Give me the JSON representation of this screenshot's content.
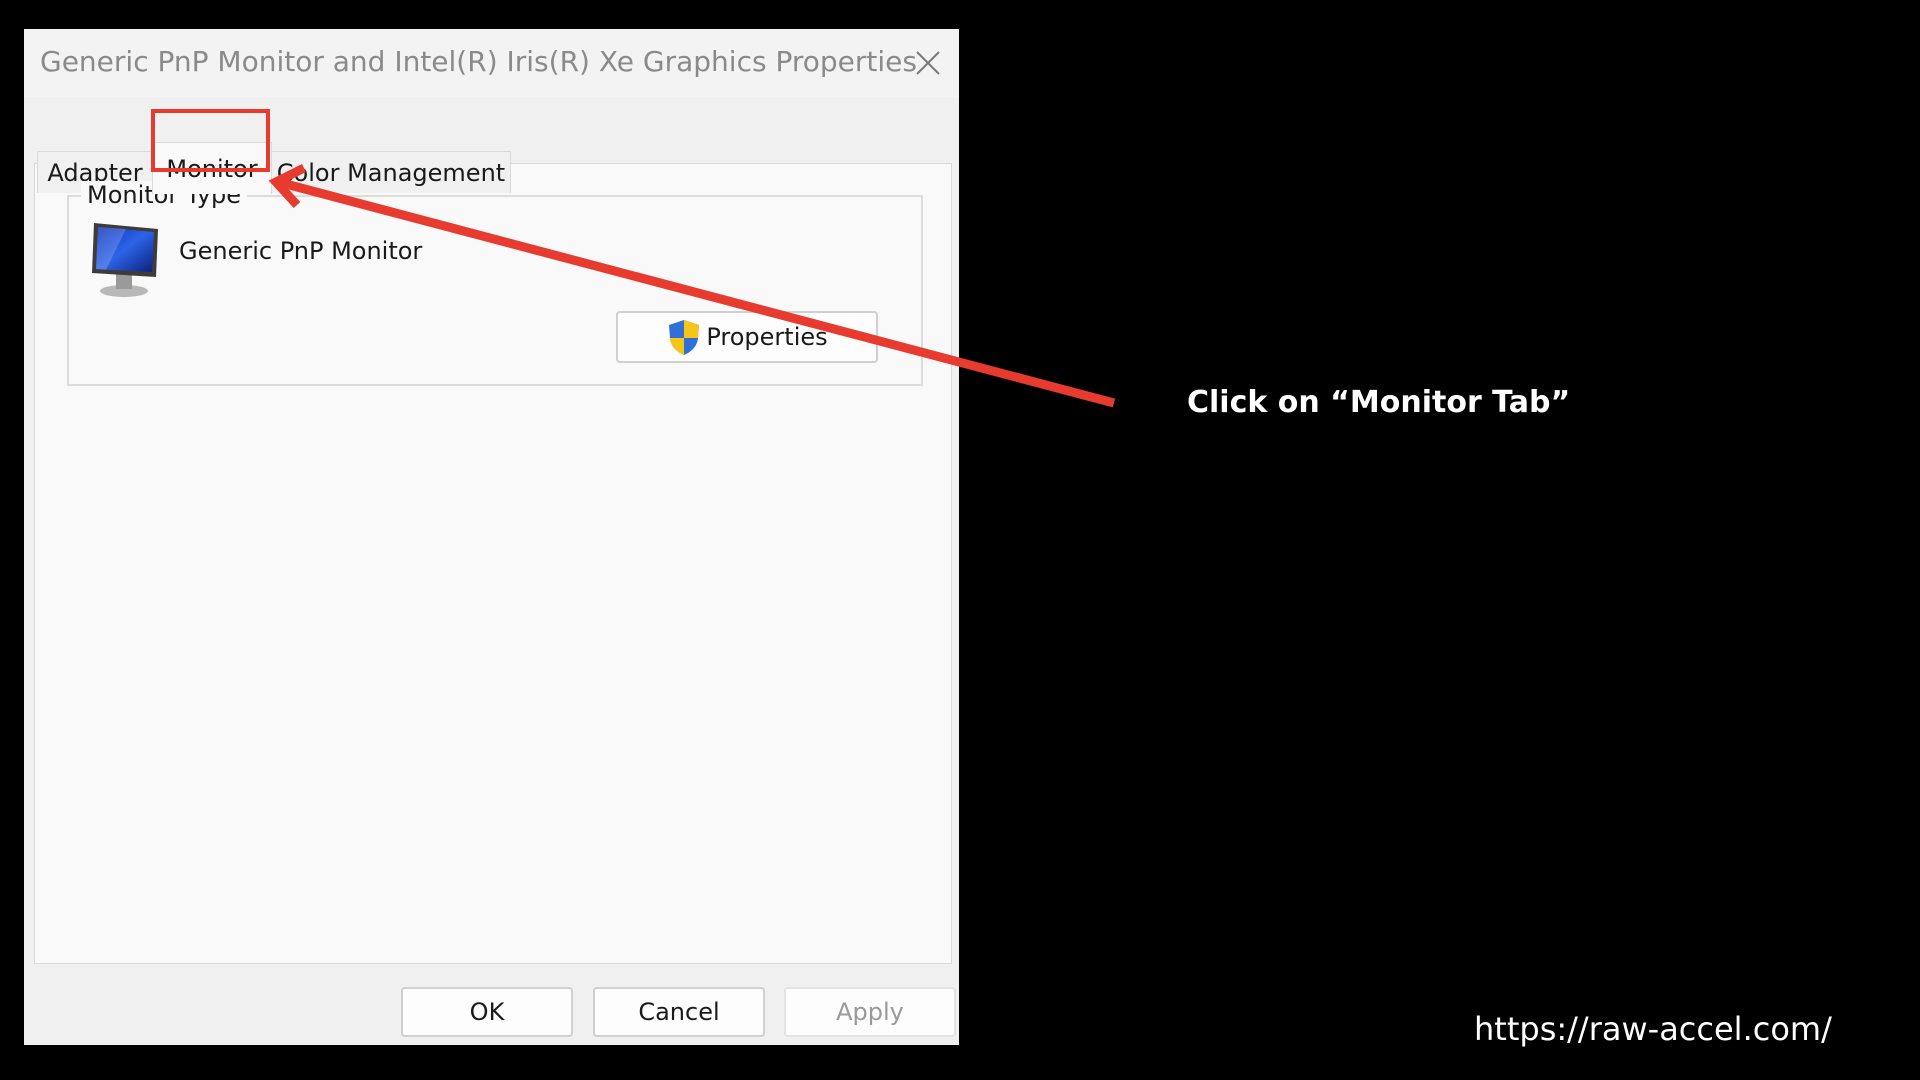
{
  "dialog": {
    "title": "Generic PnP Monitor and Intel(R) Iris(R) Xe Graphics Properties",
    "tabs": [
      {
        "label": "Adapter"
      },
      {
        "label": "Monitor"
      },
      {
        "label": "Color Management"
      }
    ],
    "monitor_type": {
      "group_label": "Monitor Type",
      "monitor_name": "Generic PnP Monitor",
      "properties_button": "Properties"
    },
    "buttons": {
      "ok": "OK",
      "cancel": "Cancel",
      "apply": "Apply"
    }
  },
  "annotation": {
    "callout": "Click on “Monitor Tab”",
    "color": "#e63b2e"
  },
  "footer": {
    "url": "https://raw-accel.com/"
  },
  "icons": {
    "close": "close-icon",
    "monitor": "monitor-icon",
    "shield": "uac-shield-icon"
  }
}
